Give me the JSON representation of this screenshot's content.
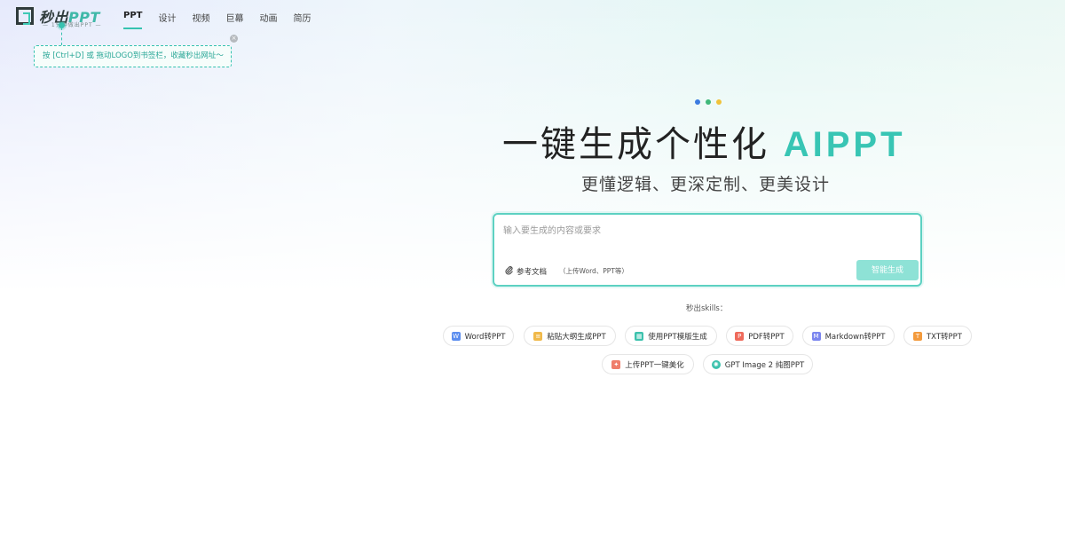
{
  "header": {
    "logo_text": "秒出PPT",
    "logo_subtitle": "— 1分钟做出PPT —",
    "nav": [
      {
        "label": "PPT",
        "active": true
      },
      {
        "label": "设计",
        "active": false
      },
      {
        "label": "视频",
        "active": false
      },
      {
        "label": "巨幕",
        "active": false
      },
      {
        "label": "动画",
        "active": false
      },
      {
        "label": "简历",
        "active": false
      }
    ]
  },
  "tooltip": {
    "text": "按 [Ctrl+D] 或 拖动LOGO到书签栏，收藏秒出网址～",
    "close_glyph": "×"
  },
  "hero": {
    "dot_colors": [
      "#3b7be0",
      "#3fb87a",
      "#f0c23a"
    ],
    "title_main": "一键生成个性化",
    "title_accent": "AIPPT",
    "subtitle": "更懂逻辑、更深定制、更美设计"
  },
  "input": {
    "value": "",
    "placeholder": "输入要生成的内容或要求",
    "attach_label": "参考文档",
    "attach_hint": "（上传Word、PPT等）",
    "generate_label": "智能生成"
  },
  "skills": {
    "label": "秒出skills：",
    "items": [
      {
        "label": "Word转PPT",
        "icon": "word-doc-icon",
        "color": "#5b8def"
      },
      {
        "label": "粘贴大纲生成PPT",
        "icon": "outline-icon",
        "color": "#f0b94a"
      },
      {
        "label": "使用PPT模版生成",
        "icon": "template-icon",
        "color": "#3cc2ad"
      },
      {
        "label": "PDF转PPT",
        "icon": "pdf-icon",
        "color": "#ef6a5b"
      },
      {
        "label": "Markdown转PPT",
        "icon": "markdown-icon",
        "color": "#7b86ef"
      },
      {
        "label": "TXT转PPT",
        "icon": "txt-icon",
        "color": "#f39a3c"
      },
      {
        "label": "上传PPT一键美化",
        "icon": "beautify-icon",
        "color": "#ef7d6a"
      },
      {
        "label": "GPT Image 2 纯图PPT",
        "icon": "gpt-icon",
        "color": "#3cc2ad"
      }
    ]
  }
}
